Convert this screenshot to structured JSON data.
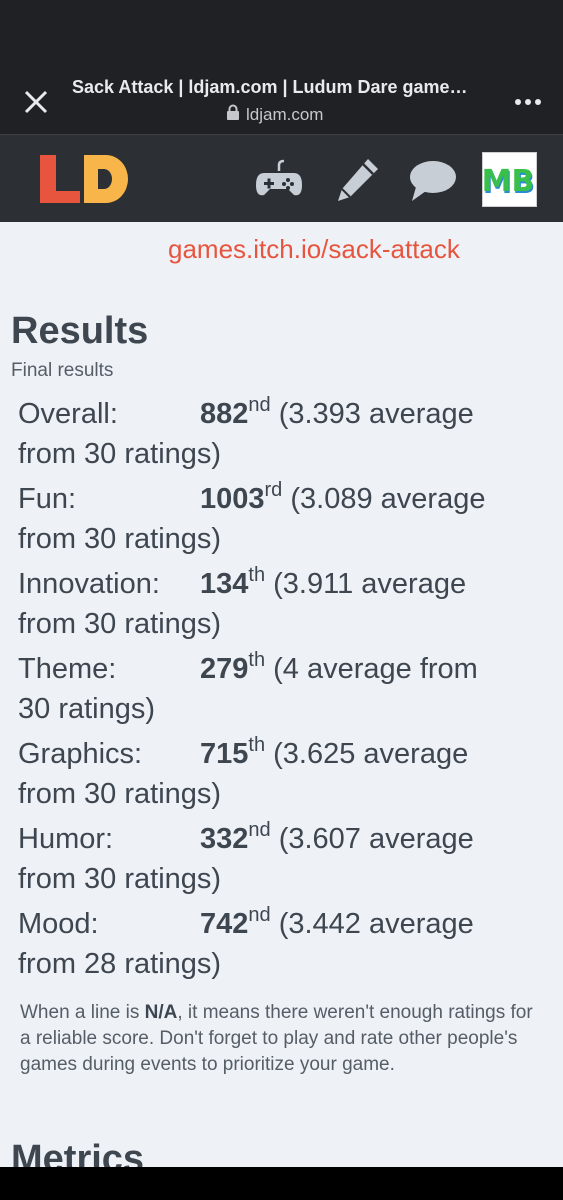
{
  "browser": {
    "tab_title": "Sack Attack | ldjam.com | Ludum Dare game…",
    "url": "ldjam.com"
  },
  "site": {
    "logo_text": "LD",
    "icons": [
      "gamepad-icon",
      "pencil-icon",
      "chat-bubble-icon"
    ],
    "avatar_initials": "MB"
  },
  "page": {
    "game_link": "games.itch.io/sack-attack",
    "results_title": "Results",
    "final_label": "Final results",
    "results": [
      {
        "category": "Overall:",
        "rank": "882",
        "suffix": "nd",
        "detail": "(3.393 average",
        "detail2": "from 30 ratings)"
      },
      {
        "category": "Fun:",
        "rank": "1003",
        "suffix": "rd",
        "detail": "(3.089 average",
        "detail2": "from 30 ratings)"
      },
      {
        "category": "Innovation:",
        "rank": "134",
        "suffix": "th",
        "detail": "(3.911 average",
        "detail2": "from 30 ratings)"
      },
      {
        "category": "Theme:",
        "rank": "279",
        "suffix": "th",
        "detail": "(4 average from",
        "detail2": "30 ratings)"
      },
      {
        "category": "Graphics:",
        "rank": "715",
        "suffix": "th",
        "detail": "(3.625 average",
        "detail2": "from 30 ratings)"
      },
      {
        "category": "Humor:",
        "rank": "332",
        "suffix": "nd",
        "detail": "(3.607 average",
        "detail2": "from 30 ratings)"
      },
      {
        "category": "Mood:",
        "rank": "742",
        "suffix": "nd",
        "detail": "(3.442 average",
        "detail2": "from 28 ratings)"
      }
    ],
    "note_before": "When a line is ",
    "note_bold": "N/A",
    "note_after": ", it means there weren't enough ratings for a reliable score. Don't forget to play and rate other people's games during events to prioritize your game.",
    "metrics_title": "Metrics"
  },
  "colors": {
    "link": "#e8553f",
    "logo_orange": "#e8553f",
    "logo_yellow": "#f8b54a",
    "text": "#3e4650"
  }
}
